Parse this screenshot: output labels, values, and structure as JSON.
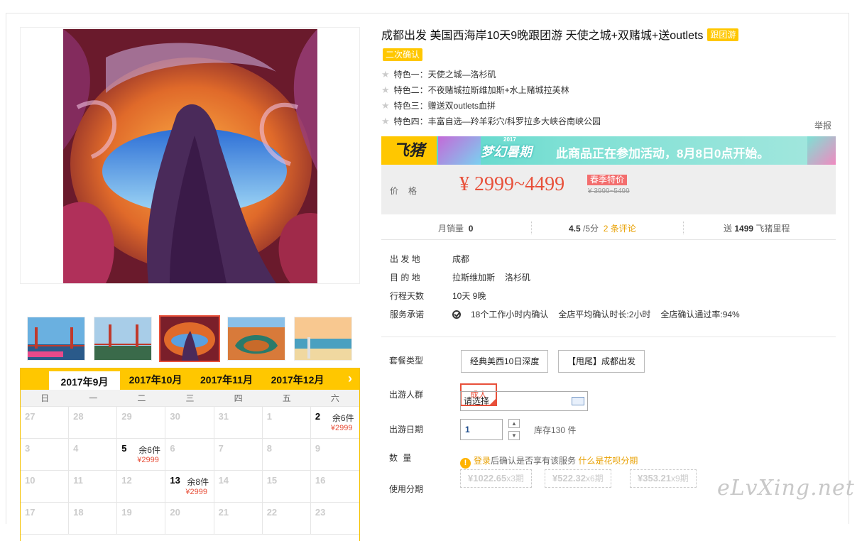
{
  "product": {
    "title": "成都出发 美国西海岸10天9晚跟团游 天使之城+双赌城+送outlets",
    "tag_type": "跟团游",
    "tag_confirm": "二次确认",
    "features": [
      "特色一：天使之城—洛杉矶",
      "特色二：不夜赌城拉斯维加斯+水上赌城拉芙林",
      "特色三：赠送双outlets血拼",
      "特色四：丰富自选—羚羊彩穴/科罗拉多大峡谷南峡公园"
    ],
    "report_link": "举报"
  },
  "banner": {
    "brand": "飞猪",
    "promo_mark": "梦幻暑期",
    "promo_year": "2017",
    "promo_text": "此商品正在参加活动，8月8日0点开始。"
  },
  "price": {
    "label": "价格",
    "value": "¥ 2999~4499",
    "badge": "春季特价",
    "original": "¥ 3999~5499"
  },
  "stats": {
    "monthly_sales_label": "月销量",
    "monthly_sales": "0",
    "rating": "4.5",
    "rating_suffix": "/5分",
    "reviews": "2 条评论",
    "points_prefix": "送",
    "points": "1499",
    "points_suffix": "飞猪里程"
  },
  "info": [
    {
      "key": "出 发 地",
      "values": [
        "成都"
      ]
    },
    {
      "key": "目 的 地",
      "values": [
        "拉斯维加斯",
        "洛杉矶"
      ]
    },
    {
      "key": "行程天数",
      "values": [
        "10天 9晚"
      ]
    },
    {
      "key": "服务承诺",
      "values": [
        "18个工作小时内确认",
        "全店平均确认时长:2小时",
        "全店确认通过率:94%"
      ]
    }
  ],
  "options": {
    "package_label": "套餐类型",
    "packages": [
      "经典美西10日深度",
      "【甩尾】成都出发"
    ],
    "people_label": "出游人群",
    "people": [
      "成人"
    ],
    "date_label": "出游日期",
    "date_placeholder": "请选择",
    "qty_label": "数 量",
    "qty_value": "1",
    "stock": "库存130 件",
    "install_label": "使用分期",
    "install_login": "登录",
    "install_text": "后确认是否享有该服务",
    "install_link": "什么是花呗分期",
    "installments": [
      {
        "amount": "¥1022.65",
        "term": "x3期"
      },
      {
        "amount": "¥522.32",
        "term": "x6期"
      },
      {
        "amount": "¥353.21",
        "term": "x9期"
      }
    ]
  },
  "calendar": {
    "months": [
      "2017年9月",
      "2017年10月",
      "2017年11月",
      "2017年12月"
    ],
    "active_month": 0,
    "weekdays": [
      "日",
      "一",
      "二",
      "三",
      "四",
      "五",
      "六"
    ],
    "days": [
      {
        "d": "27"
      },
      {
        "d": "28"
      },
      {
        "d": "29"
      },
      {
        "d": "30"
      },
      {
        "d": "31"
      },
      {
        "d": "1"
      },
      {
        "d": "2",
        "stock": "余6件",
        "price": "¥2999"
      },
      {
        "d": "3"
      },
      {
        "d": "4"
      },
      {
        "d": "5",
        "stock": "余6件",
        "price": "¥2999"
      },
      {
        "d": "6"
      },
      {
        "d": "7"
      },
      {
        "d": "8"
      },
      {
        "d": "9"
      },
      {
        "d": "10"
      },
      {
        "d": "11"
      },
      {
        "d": "12"
      },
      {
        "d": "13",
        "stock": "余8件",
        "price": "¥2999"
      },
      {
        "d": "14"
      },
      {
        "d": "15"
      },
      {
        "d": "16"
      },
      {
        "d": "17"
      },
      {
        "d": "18"
      },
      {
        "d": "19"
      },
      {
        "d": "20"
      },
      {
        "d": "21"
      },
      {
        "d": "22"
      },
      {
        "d": "23"
      }
    ]
  },
  "watermark": "eLvXing.net"
}
